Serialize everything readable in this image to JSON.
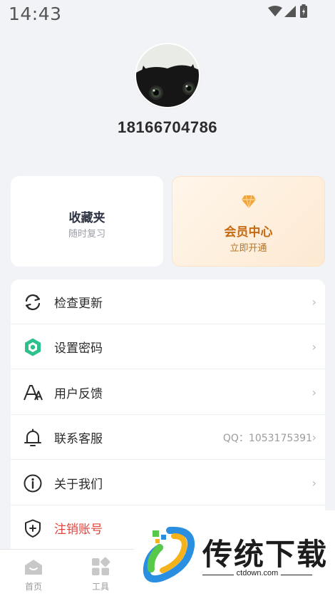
{
  "status_bar": {
    "time": "14:43",
    "icons": [
      "wifi-icon",
      "cell-signal-icon",
      "battery-icon"
    ]
  },
  "profile": {
    "avatar": "avatar",
    "username": "18166704786"
  },
  "cards": {
    "favorites": {
      "title": "收藏夹",
      "subtitle": "随时复习"
    },
    "vip": {
      "title": "会员中心",
      "subtitle": "立即开通",
      "icon": "diamond-icon"
    }
  },
  "menu": {
    "items": [
      {
        "label": "检查更新",
        "icon": "refresh-icon",
        "extra": ""
      },
      {
        "label": "设置密码",
        "icon": "hexagon-lock-icon",
        "extra": ""
      },
      {
        "label": "用户反馈",
        "icon": "font-feedback-icon",
        "extra": ""
      },
      {
        "label": "联系客服",
        "icon": "bell-icon",
        "extra": "QQ：1053175391"
      },
      {
        "label": "关于我们",
        "icon": "info-icon",
        "extra": ""
      },
      {
        "label": "注销账号",
        "icon": "shield-plus-icon",
        "extra": ""
      }
    ],
    "chevron": "›"
  },
  "tabbar": {
    "tabs": [
      {
        "label": "首页",
        "icon": "home-icon"
      },
      {
        "label": "工具",
        "icon": "grid-icon"
      }
    ]
  },
  "watermark": {
    "title": "传统下载",
    "url": "ctdown.com"
  },
  "colors": {
    "background": "#f2f3f7",
    "vip_text": "#c66a12",
    "danger": "#e0443e",
    "diamond": "#f0a43a",
    "password_icon": "#2fc18c"
  }
}
